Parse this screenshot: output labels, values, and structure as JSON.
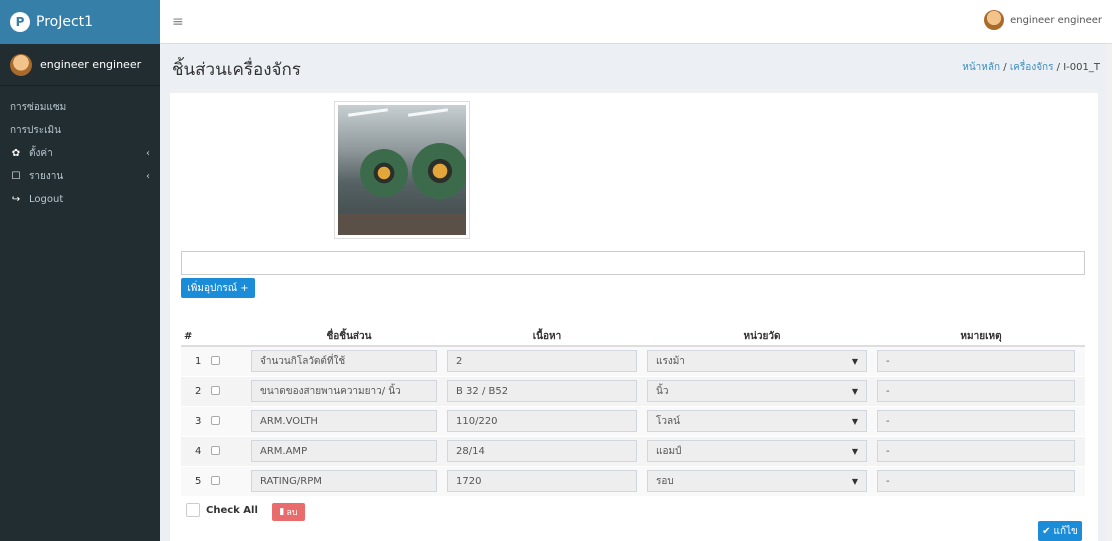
{
  "app": {
    "brand": "ProJect1",
    "logo_glyph": "P"
  },
  "user": {
    "name": "engineer engineer"
  },
  "sidebar": {
    "items": [
      {
        "label": "การซ่อมแซม",
        "icon": "file-icon",
        "glyph": ""
      },
      {
        "label": "การประเมิน",
        "icon": "clipboard-icon",
        "glyph": ""
      },
      {
        "label": "ตั้งค่า",
        "icon": "gear-icon",
        "glyph": "✿",
        "has_submenu": true
      },
      {
        "label": "รายงาน",
        "icon": "report-icon",
        "glyph": "☐",
        "has_submenu": true
      },
      {
        "label": "Logout",
        "icon": "sign-out-icon",
        "glyph": "↪"
      }
    ],
    "chevron": "‹"
  },
  "topbar": {
    "hamburger": "≡"
  },
  "header": {
    "title": "ชิ้นส่วนเครื่องจักร",
    "breadcrumb": {
      "home": "หน้าหลัก",
      "section": "เครื่องจักร",
      "current": "I-001_T",
      "sep": "/"
    }
  },
  "form": {
    "add_button": "เพิ่มอุปกรณ์ +",
    "wide_input_value": ""
  },
  "table": {
    "headers": {
      "num": "#",
      "name": "ชื่อชิ้นส่วน",
      "content": "เนื้อหา",
      "unit": "หน่วยวัด",
      "note": "หมายเหตุ"
    },
    "rows": [
      {
        "num": "1",
        "name": "จำนวนกิโลวัตต์ที่ใช้",
        "content": "2",
        "unit": "แรงม้า",
        "note": "-"
      },
      {
        "num": "2",
        "name": "ขนาดของสายพานความยาว/ นิ้ว",
        "content": "B 32 / B52",
        "unit": "นิ้ว",
        "note": "-"
      },
      {
        "num": "3",
        "name": "ARM.VOLTH",
        "content": "110/220",
        "unit": "โวลน์",
        "note": "-"
      },
      {
        "num": "4",
        "name": "ARM.AMP",
        "content": "28/14",
        "unit": "แอมป์",
        "note": "-"
      },
      {
        "num": "5",
        "name": "RATING/RPM",
        "content": "1720",
        "unit": "รอบ",
        "note": "-"
      }
    ],
    "caret": "▼"
  },
  "footer": {
    "check_all": "Check All",
    "delete_button": "ลบ",
    "edit_button": "แก้ไข"
  },
  "colors": {
    "sidebar_bg": "#222d32",
    "brand_bg": "#367fa9",
    "primary": "#1a8cd8",
    "danger": "#e96c6c"
  }
}
